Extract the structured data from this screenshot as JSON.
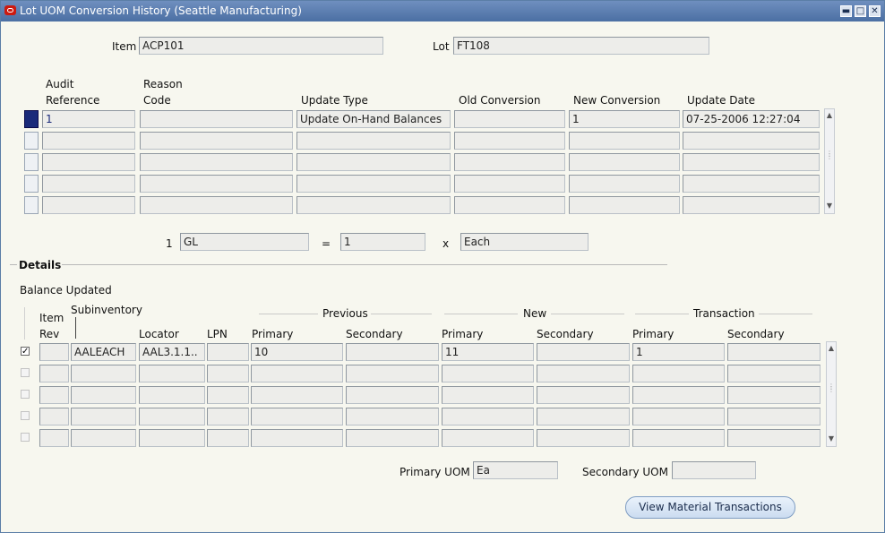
{
  "window": {
    "title": "Lot UOM Conversion History  (Seattle Manufacturing)",
    "controls": [
      "minimize-icon",
      "maximize-icon",
      "close-icon"
    ]
  },
  "header": {
    "item_label": "Item",
    "item_value": "ACP101",
    "lot_label": "Lot",
    "lot_value": "FT108"
  },
  "history": {
    "columns": {
      "audit_reference": "Audit\nReference",
      "audit_line1": "Audit",
      "audit_line2": "Reference",
      "reason_line1": "Reason",
      "reason_line2": "Code",
      "update_type": "Update Type",
      "old_conversion": "Old Conversion",
      "new_conversion": "New Conversion",
      "update_date": "Update Date"
    },
    "rows": [
      {
        "audit": "1",
        "reason": "",
        "update_type": "Update On-Hand Balances",
        "old": "",
        "new": "1",
        "date": "07-25-2006 12:27:04"
      },
      {
        "audit": "",
        "reason": "",
        "update_type": "",
        "old": "",
        "new": "",
        "date": ""
      },
      {
        "audit": "",
        "reason": "",
        "update_type": "",
        "old": "",
        "new": "",
        "date": ""
      },
      {
        "audit": "",
        "reason": "",
        "update_type": "",
        "old": "",
        "new": "",
        "date": ""
      },
      {
        "audit": "",
        "reason": "",
        "update_type": "",
        "old": "",
        "new": "",
        "date": ""
      }
    ]
  },
  "conversion": {
    "qty": "1",
    "from_uom": "GL",
    "equals": "=",
    "value": "1",
    "times": "x",
    "to_uom": "Each"
  },
  "details": {
    "section_label": "Details",
    "balance_updated_label": "Balance Updated",
    "group_headers": {
      "previous": "Previous",
      "new": "New",
      "transaction": "Transaction"
    },
    "columns": {
      "item_rev_line1": "Item",
      "item_rev_line2": "Rev",
      "subinventory": "Subinventory",
      "locator": "Locator",
      "lpn": "LPN",
      "primary": "Primary",
      "secondary": "Secondary"
    },
    "rows": [
      {
        "checked": true,
        "rev": "",
        "subinv": "AALEACH",
        "locator": "AAL3.1.1..",
        "lpn": "",
        "prev_primary": "10",
        "prev_secondary": "",
        "new_primary": "11",
        "new_secondary": "",
        "txn_primary": "1",
        "txn_secondary": ""
      },
      {
        "checked": false,
        "rev": "",
        "subinv": "",
        "locator": "",
        "lpn": "",
        "prev_primary": "",
        "prev_secondary": "",
        "new_primary": "",
        "new_secondary": "",
        "txn_primary": "",
        "txn_secondary": ""
      },
      {
        "checked": false,
        "rev": "",
        "subinv": "",
        "locator": "",
        "lpn": "",
        "prev_primary": "",
        "prev_secondary": "",
        "new_primary": "",
        "new_secondary": "",
        "txn_primary": "",
        "txn_secondary": ""
      },
      {
        "checked": false,
        "rev": "",
        "subinv": "",
        "locator": "",
        "lpn": "",
        "prev_primary": "",
        "prev_secondary": "",
        "new_primary": "",
        "new_secondary": "",
        "txn_primary": "",
        "txn_secondary": ""
      },
      {
        "checked": false,
        "rev": "",
        "subinv": "",
        "locator": "",
        "lpn": "",
        "prev_primary": "",
        "prev_secondary": "",
        "new_primary": "",
        "new_secondary": "",
        "txn_primary": "",
        "txn_secondary": ""
      }
    ]
  },
  "footer": {
    "primary_uom_label": "Primary UOM",
    "primary_uom_value": "Ea",
    "secondary_uom_label": "Secondary UOM",
    "secondary_uom_value": "",
    "view_transactions_button": "View Material Transactions"
  }
}
